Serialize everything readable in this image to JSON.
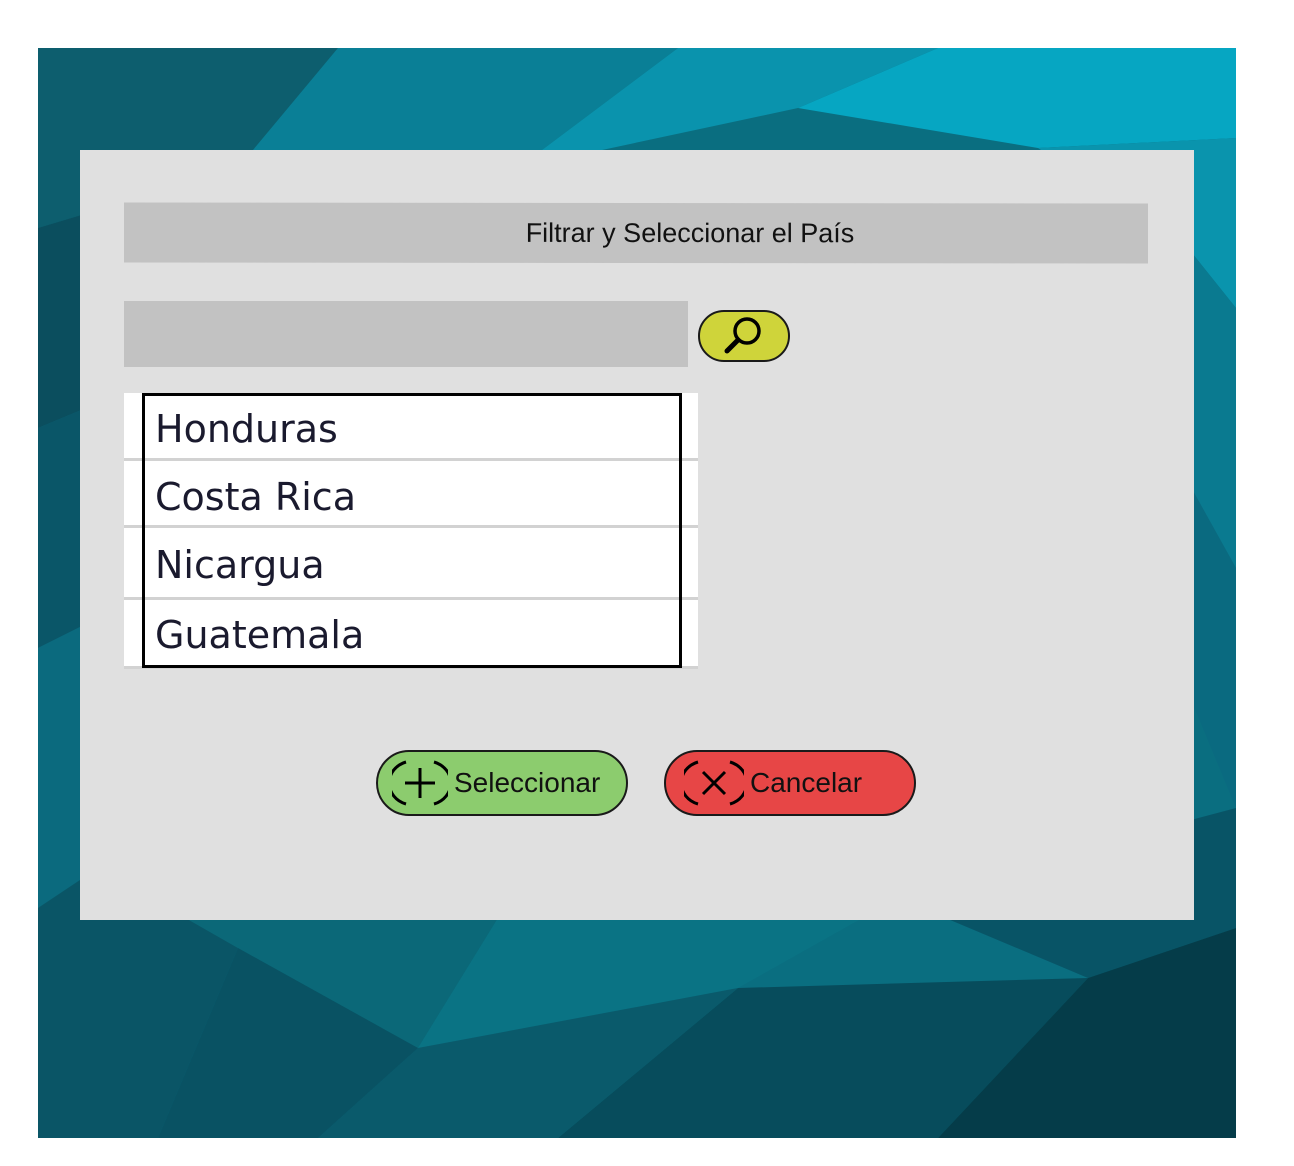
{
  "dialog": {
    "title": "Filtrar y Seleccionar el País",
    "search": {
      "value": "",
      "placeholder": "",
      "icon": "magnifier-icon",
      "accent": "#cfd43a"
    },
    "countries": [
      "Honduras",
      "Costa Rica",
      "Nicargua",
      "Guatemala"
    ],
    "buttons": {
      "select_label": "Seleccionar",
      "select_icon": "plus-circle-icon",
      "select_color": "#8ccc6e",
      "cancel_label": "Cancelar",
      "cancel_icon": "close-circle-icon",
      "cancel_color": "#e74646"
    }
  },
  "colors": {
    "background": "#0a6e80",
    "dialog": "#e0e0e0",
    "field": "#c2c2c2"
  }
}
